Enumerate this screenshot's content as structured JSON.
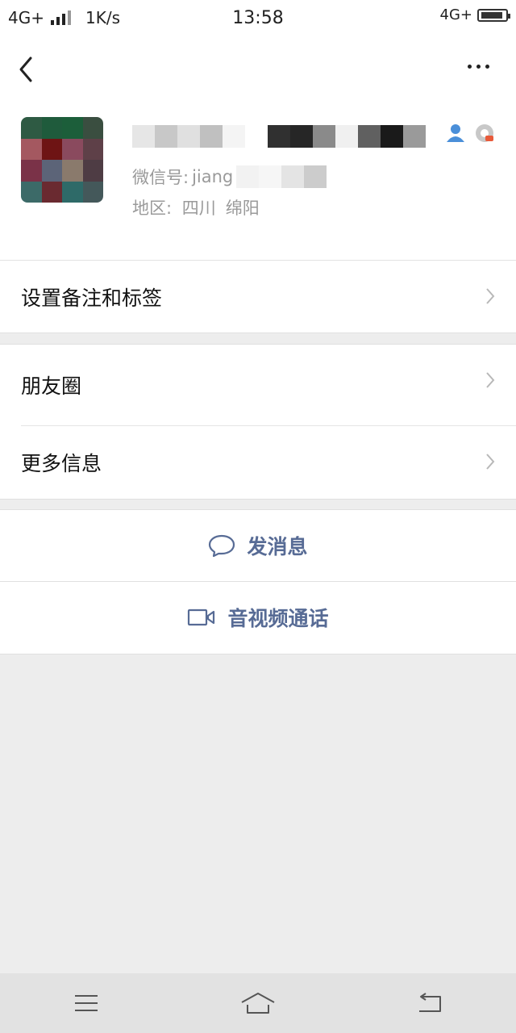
{
  "status_bar": {
    "network_left": "4G+",
    "speed": "1K/s",
    "time": "13:58",
    "network_right": "4G+"
  },
  "top_bar": {
    "back_icon": "chevron-left-icon",
    "more_icon": "more-dots-icon"
  },
  "profile": {
    "wechat_id_label": "微信号:",
    "wechat_id_value": "jiang",
    "region_label": "地区:",
    "region_province": "四川",
    "region_city": "绵阳"
  },
  "menu": {
    "remark_tags": "设置备注和标签",
    "moments": "朋友圈",
    "more_info": "更多信息"
  },
  "actions": {
    "send_message": "发消息",
    "video_call": "音视频通话"
  },
  "colors": {
    "link_blue": "#576b95",
    "background": "#ededed",
    "nav_bar": "#e2e2e2"
  }
}
